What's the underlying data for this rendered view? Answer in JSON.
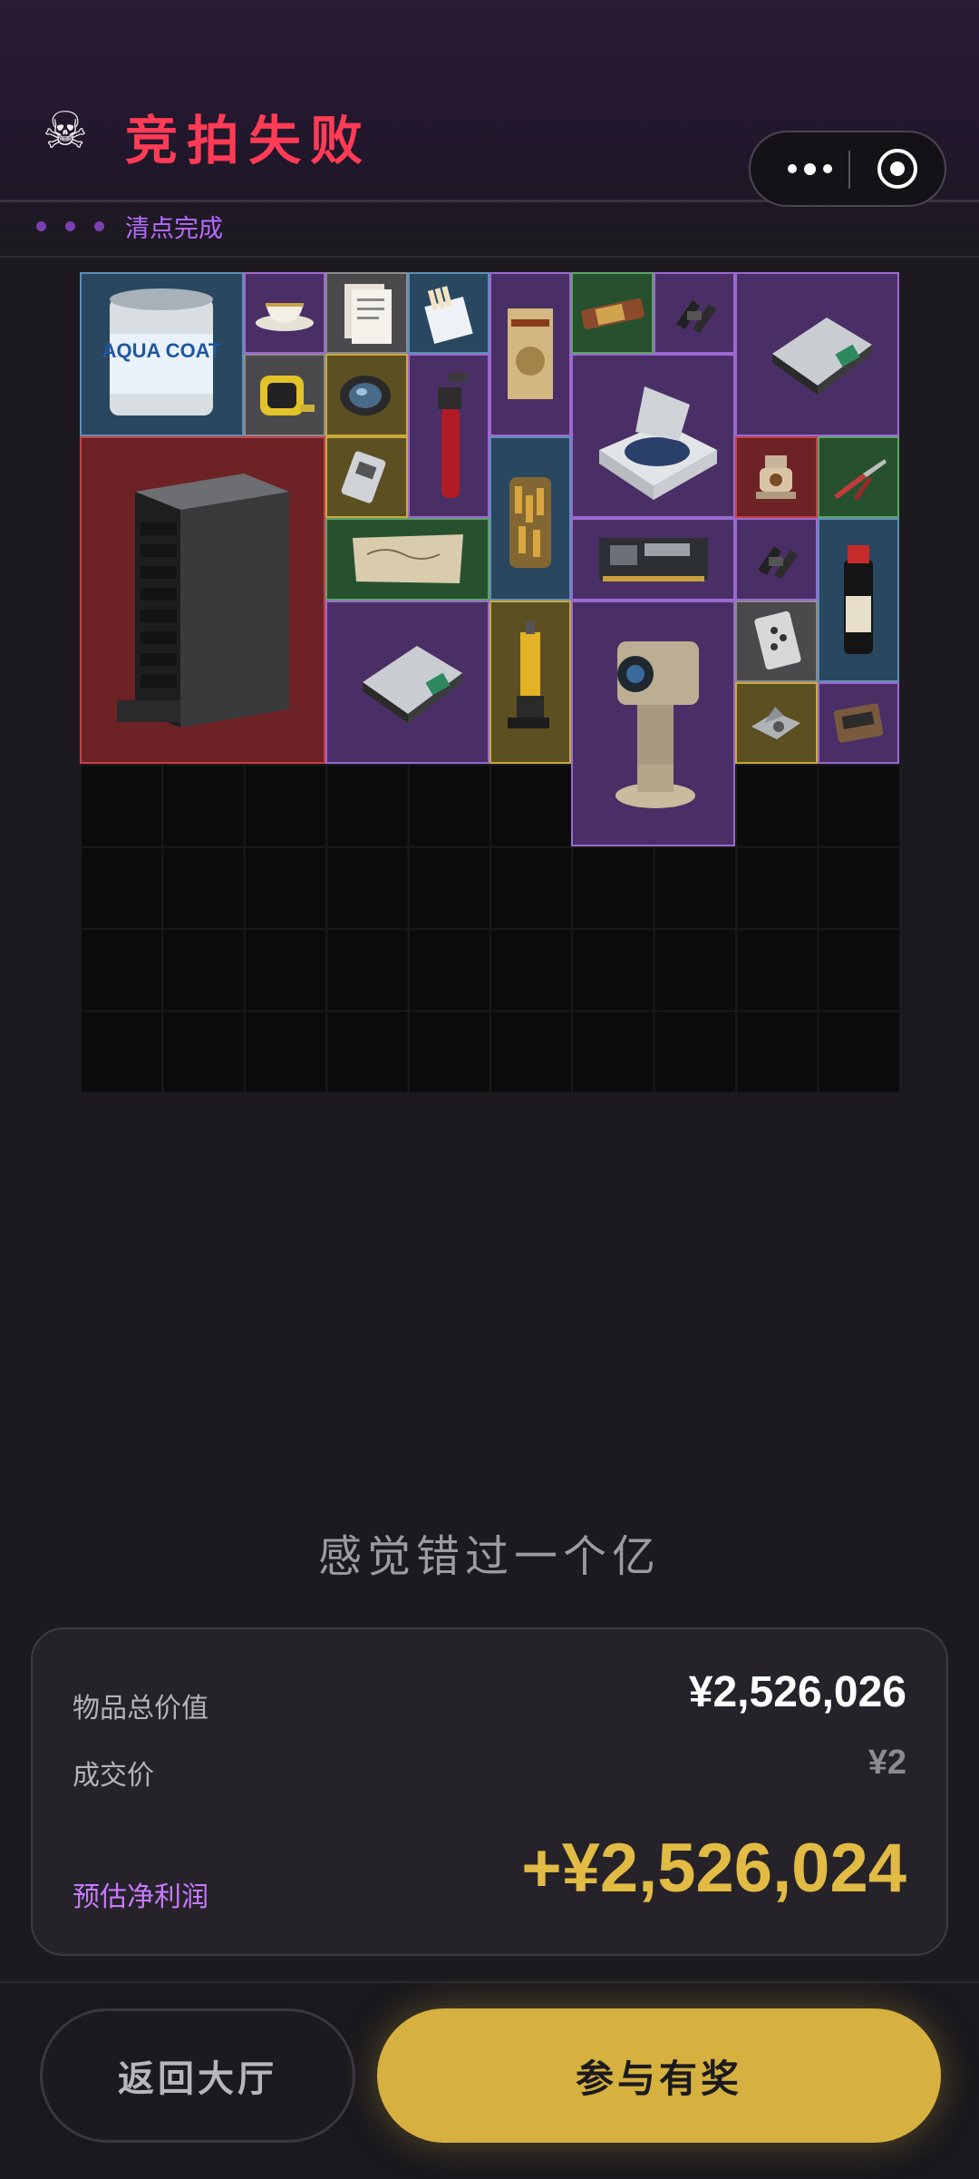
{
  "header": {
    "title": "竞拍失败",
    "skull_icon": "skull-icon"
  },
  "status": {
    "label": "清点完成"
  },
  "items": [
    {
      "id": "paint-can",
      "rarity": "blue",
      "icon": "paint-bucket-icon",
      "label": "AQUA COAT"
    },
    {
      "id": "teacup",
      "rarity": "purple",
      "icon": "teacup-icon"
    },
    {
      "id": "documents",
      "rarity": "grey",
      "icon": "document-icon"
    },
    {
      "id": "cigarettes",
      "rarity": "blue",
      "icon": "cigarette-pack-icon"
    },
    {
      "id": "black-tide-book",
      "rarity": "purple",
      "icon": "book-icon"
    },
    {
      "id": "energy-bar",
      "rarity": "green",
      "icon": "snack-icon"
    },
    {
      "id": "clip-1",
      "rarity": "purple",
      "icon": "clip-icon"
    },
    {
      "id": "gpu-box-1",
      "rarity": "purple",
      "icon": "hardware-box-icon"
    },
    {
      "id": "tape-measure",
      "rarity": "grey",
      "icon": "tape-measure-icon"
    },
    {
      "id": "lens",
      "rarity": "gold",
      "icon": "lens-icon"
    },
    {
      "id": "gas-torch",
      "rarity": "purple",
      "icon": "torch-icon"
    },
    {
      "id": "centrifuge",
      "rarity": "purple",
      "icon": "centrifuge-icon"
    },
    {
      "id": "server-rack",
      "rarity": "red",
      "icon": "server-icon"
    },
    {
      "id": "ssd",
      "rarity": "gold",
      "icon": "ssd-icon"
    },
    {
      "id": "ammo-jar",
      "rarity": "blue",
      "icon": "ammo-icon"
    },
    {
      "id": "valve",
      "rarity": "red",
      "icon": "valve-icon"
    },
    {
      "id": "pliers",
      "rarity": "green",
      "icon": "pliers-icon"
    },
    {
      "id": "treasure-map",
      "rarity": "green",
      "icon": "map-icon"
    },
    {
      "id": "circuit-board",
      "rarity": "purple",
      "icon": "circuit-board-icon"
    },
    {
      "id": "clip-2",
      "rarity": "purple",
      "icon": "clip-icon"
    },
    {
      "id": "black-powder",
      "rarity": "blue",
      "icon": "bottle-icon"
    },
    {
      "id": "gpu-box-2",
      "rarity": "purple",
      "icon": "hardware-box-icon"
    },
    {
      "id": "hydraulic-jack",
      "rarity": "gold",
      "icon": "jack-icon"
    },
    {
      "id": "camera-turret",
      "rarity": "purple",
      "icon": "camera-turret-icon"
    },
    {
      "id": "playing-card",
      "rarity": "grey",
      "icon": "card-icon"
    },
    {
      "id": "drone-part",
      "rarity": "gold",
      "icon": "drone-icon"
    },
    {
      "id": "cassette",
      "rarity": "purple",
      "icon": "cassette-icon"
    }
  ],
  "slogan": "感觉错过一个亿",
  "summary": {
    "total_label": "物品总价值",
    "total_value": "¥2,526,026",
    "deal_label": "成交价",
    "deal_value": "¥2",
    "profit_label": "预估净利润",
    "profit_value": "+¥2,526,024"
  },
  "buttons": {
    "back": "返回大厅",
    "join": "参与有奖"
  },
  "colors": {
    "title": "#ff3b56",
    "accent": "#b66cff",
    "gold": "#d6b13f"
  }
}
